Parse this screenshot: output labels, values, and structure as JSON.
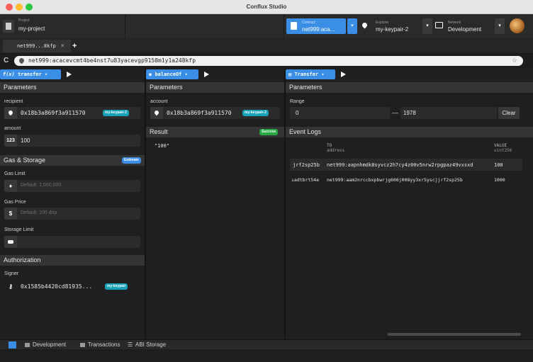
{
  "window": {
    "title": "Conflux Studio"
  },
  "header": {
    "project": {
      "label": "Project",
      "value": "my-project"
    },
    "contract": {
      "label": "Contract",
      "value": "net999:aca..."
    },
    "explorer": {
      "label": "Explorer",
      "value": "my-keypair-2"
    },
    "network": {
      "label": "Network",
      "value": "Development"
    }
  },
  "tabs": [
    {
      "label": "net999...8kfp",
      "close": "×"
    }
  ],
  "tab_add": "+",
  "address_bar": {
    "value": "net999:acacevcmt4be4nst7u83yacevgp9158m1y1a248kfp"
  },
  "col1": {
    "function": "transfer",
    "parameters_title": "Parameters",
    "recipient_label": "recipient",
    "recipient_value": "0x18b3a869f3a911570",
    "recipient_badge": "my-keypair-2",
    "amount_label": "amount",
    "amount_icon": "123",
    "amount_value": "100",
    "gas_title": "Gas & Storage",
    "estimate_label": "Estimate",
    "gas_limit_label": "Gas Limit",
    "gas_limit_placeholder": "Default: 1,000,000",
    "gas_price_label": "Gas Price",
    "gas_price_icon": "$",
    "gas_price_placeholder": "Default: 100 drip",
    "storage_limit_label": "Storage Limit",
    "auth_title": "Authorization",
    "signer_label": "Signer",
    "signer_value": "0x1585b4420cd81935...",
    "signer_badge": "my-keypair"
  },
  "col2": {
    "function": "balanceOf",
    "parameters_title": "Parameters",
    "account_label": "account",
    "account_value": "0x18b3a869f3a911570",
    "account_badge": "my-keypair-2",
    "result_title": "Result",
    "result_status": "Success",
    "result_value": "\"100\""
  },
  "col3": {
    "event": "Transfer",
    "parameters_title": "Parameters",
    "range_label": "Range",
    "range_from": "0",
    "range_dash": "—",
    "range_to": "1978",
    "clear_label": "Clear",
    "logs_title": "Event Logs",
    "col_to": "TO",
    "col_to_type": "address",
    "col_value": "VALUE",
    "col_value_type": "uint256",
    "rows": [
      {
        "from": "jrf2sp25b",
        "to": "net999:aapnhmdk8syvcz2h7cy4z00v5nrw2rpgpaz49vxsxd",
        "value": "100"
      },
      {
        "from": "ıadtbrt54e",
        "to": "net999:aam2nrccbxpbwrjg606j008yy3xr5yscjjrf2sp25b",
        "value": "1000"
      }
    ]
  },
  "statusbar": {
    "development": "Development",
    "transactions": "Transactions",
    "abi_storage": "ABI Storage"
  },
  "colors": {
    "accent": "#3a8ee6",
    "success": "#28a745",
    "badge": "#17a2b8"
  },
  "icons": [
    "pin-icon",
    "play-icon",
    "eye-icon",
    "function-icon",
    "refresh-icon",
    "star-icon",
    "fire-icon",
    "key-icon",
    "drive-icon"
  ]
}
